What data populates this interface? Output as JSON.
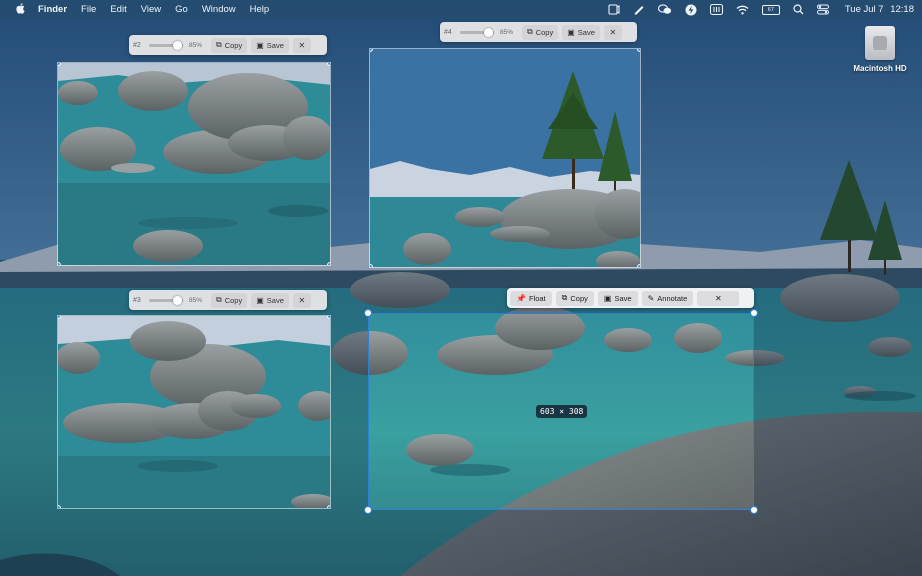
{
  "menubar": {
    "app_name": "Finder",
    "menus": [
      "File",
      "Edit",
      "View",
      "Go",
      "Window",
      "Help"
    ],
    "battery_level": "67",
    "clock_day": "Tue Jul 7",
    "clock_time": "12:18",
    "status_icons": [
      "screenshot-icon",
      "pen-icon",
      "wechat-icon",
      "lightning-icon",
      "input-method-icon",
      "wifi-icon",
      "battery-icon",
      "search-icon",
      "control-center-icon"
    ]
  },
  "desktop": {
    "drive_label": "Macintosh HD"
  },
  "pins": [
    {
      "id": "#2",
      "opacity": "85%",
      "opacity_value": 0.85,
      "copy_label": "Copy",
      "save_label": "Save",
      "close_label": "✕"
    },
    {
      "id": "#4",
      "opacity": "85%",
      "opacity_value": 0.85,
      "copy_label": "Copy",
      "save_label": "Save",
      "close_label": "✕"
    },
    {
      "id": "#3",
      "opacity": "85%",
      "opacity_value": 0.85,
      "copy_label": "Copy",
      "save_label": "Save",
      "close_label": "✕"
    }
  ],
  "selection": {
    "size_label": "603 × 308",
    "toolbar": {
      "float_label": "Float",
      "copy_label": "Copy",
      "save_label": "Save",
      "annotate_label": "Annotate",
      "close_label": "✕"
    }
  },
  "colors": {
    "selection_accent": "#2f7fd6",
    "lake": "#2b8a96",
    "sky": "#3a74a6"
  }
}
